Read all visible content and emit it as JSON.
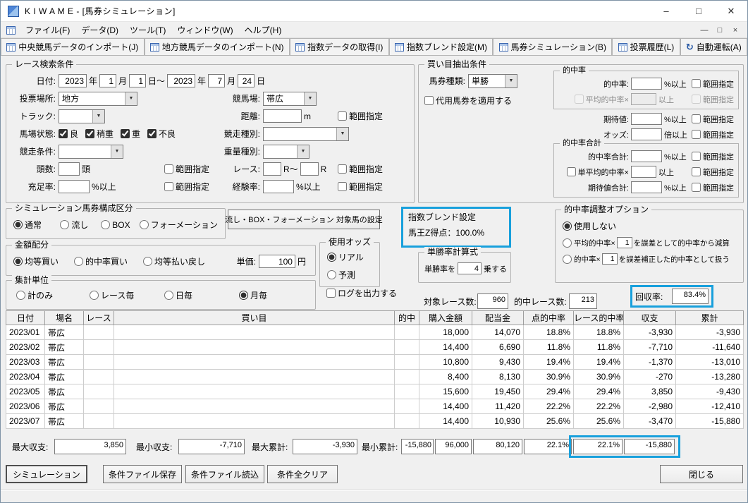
{
  "colors": {
    "highlight": "#18a0dc"
  },
  "icons": {
    "minimize": "–",
    "maximize": "□",
    "close": "✕",
    "dropdown": "▼",
    "auto_run": "↻",
    "mdi_minimize": "—",
    "mdi_restore": "□",
    "mdi_close": "×"
  },
  "labels": {
    "range": "範囲指定"
  },
  "titlebar": {
    "title": "K I W A M E - [馬券シミュレーション]"
  },
  "menubar": {
    "items": [
      "ファイル(F)",
      "データ(D)",
      "ツール(T)",
      "ウィンドウ(W)",
      "ヘルプ(H)"
    ]
  },
  "toolbar": {
    "buttons": [
      "中央競馬データのインポート(J)",
      "地方競馬データのインポート(N)",
      "指数データの取得(I)",
      "指数ブレンド設定(M)",
      "馬券シミュレーション(B)",
      "投票履歴(L)",
      "自動運転(A)"
    ]
  },
  "search": {
    "title": "レース検索条件",
    "date": {
      "label": "日付:",
      "year1": "2023",
      "year1_unit": "年",
      "month1": "1",
      "month1_unit": "月",
      "day1": "1",
      "day1_unit": "日～",
      "year2": "2023",
      "year2_unit": "年",
      "month2": "7",
      "month2_unit": "月",
      "day2": "24",
      "day2_unit": "日"
    },
    "place": {
      "label": "投票場所:",
      "value": "地方"
    },
    "course": {
      "label": "競馬場:",
      "value": "帯広"
    },
    "track": {
      "label": "トラック:",
      "value": ""
    },
    "distance": {
      "label": "距離:",
      "value": "",
      "unit": "m"
    },
    "condition": {
      "label": "馬場状態:",
      "options": [
        {
          "label": "良",
          "checked": true
        },
        {
          "label": "稍重",
          "checked": true
        },
        {
          "label": "重",
          "checked": true
        },
        {
          "label": "不良",
          "checked": true
        }
      ]
    },
    "race_type": {
      "label": "競走種別:",
      "value": ""
    },
    "race_cond": {
      "label": "競走条件:",
      "value": ""
    },
    "weight_type": {
      "label": "重量種別:",
      "value": ""
    },
    "heads": {
      "label": "頭数:",
      "value": "",
      "unit": "頭"
    },
    "race_no": {
      "label": "レース:",
      "value1": "",
      "unit1": "R～",
      "value2": "",
      "unit2": "R"
    },
    "fill_rate": {
      "label": "充足率:",
      "value": "",
      "unit": "%以上"
    },
    "exp_rate": {
      "label": "経験率:",
      "value": "",
      "unit": "%以上"
    }
  },
  "extract": {
    "title": "買い目抽出条件",
    "ticket_type": {
      "label": "馬券種類:",
      "value": "単勝"
    },
    "substitute": {
      "label": "代用馬券を適用する",
      "checked": false
    },
    "hit_group": {
      "title": "的中率"
    },
    "hit": {
      "label": "的中率:",
      "value": "",
      "unit": "%以上"
    },
    "avg_hit": {
      "label": "平均的中率×",
      "checked": false,
      "value": "",
      "unit": "以上"
    },
    "expect": {
      "label": "期待値:",
      "value": "",
      "unit": "%以上"
    },
    "odds": {
      "label": "オッズ:",
      "value": "",
      "unit": "倍以上"
    },
    "total_group": {
      "title": "的中率合計"
    },
    "hit_total": {
      "label": "的中率合計:",
      "value": "",
      "unit": "%以上"
    },
    "single_avg": {
      "label": "単平均的中率×",
      "checked": false,
      "value": "",
      "unit": "以上"
    },
    "expect_total": {
      "label": "期待値合計:",
      "value": "",
      "unit": "%以上"
    }
  },
  "composition": {
    "title": "シミュレーション馬券構成区分",
    "options": [
      {
        "label": "通常",
        "checked": true
      },
      {
        "label": "流し",
        "checked": false
      },
      {
        "label": "BOX",
        "checked": false
      },
      {
        "label": "フォーメーション",
        "checked": false
      }
    ],
    "target_button": "流し・BOX・フォーメーション 対象馬の設定"
  },
  "blend": {
    "title": "指数ブレンド設定",
    "text": "馬王Z得点：100.0%"
  },
  "adjust": {
    "title": "的中率調整オプション",
    "option1": {
      "label": "使用しない",
      "checked": true
    },
    "option2": {
      "pre": "平均的中率×",
      "value": "1",
      "post": "を誤差として的中率から減算",
      "checked": false
    },
    "option3": {
      "pre": "的中率×",
      "value": "1",
      "post": "を誤差補正した的中率として扱う",
      "checked": false
    }
  },
  "amount": {
    "title": "金額配分",
    "options": [
      {
        "label": "均等買い",
        "checked": true
      },
      {
        "label": "的中率買い",
        "checked": false
      },
      {
        "label": "均等払い戻し",
        "checked": false
      }
    ],
    "unit_price": {
      "label": "単価:",
      "value": "100",
      "unit": "円"
    }
  },
  "odds_use": {
    "title": "使用オッズ",
    "options": [
      {
        "label": "リアル",
        "checked": true
      },
      {
        "label": "予測",
        "checked": false
      }
    ]
  },
  "win_formula": {
    "title": "単勝率計算式",
    "pre": "単勝率を",
    "value": "4",
    "post": "乗する"
  },
  "aggregate": {
    "title": "集計単位",
    "options": [
      {
        "label": "計のみ",
        "checked": false
      },
      {
        "label": "レース毎",
        "checked": false
      },
      {
        "label": "日毎",
        "checked": false
      },
      {
        "label": "月毎",
        "checked": true
      }
    ]
  },
  "log_output": {
    "label": "ログを出力する",
    "checked": false
  },
  "stats": {
    "target_label": "対象レース数:",
    "target_value": "960",
    "hit_label": "的中レース数:",
    "hit_value": "213",
    "recovery_label": "回収率:",
    "recovery_value": "83.4%"
  },
  "table": {
    "columns": [
      "日付",
      "場名",
      "レース",
      "買い目",
      "的中",
      "購入金額",
      "配当金",
      "点的中率",
      "レース的中率",
      "収支",
      "累計"
    ],
    "row_keys": [
      "date",
      "place",
      "race",
      "kaime",
      "hit",
      "purchase",
      "payout",
      "point_rate",
      "race_rate",
      "balance",
      "total"
    ],
    "rows": [
      {
        "date": "2023/01",
        "place": "帯広",
        "race": "",
        "kaime": "",
        "hit": "",
        "purchase": "18,000",
        "payout": "14,070",
        "point_rate": "18.8%",
        "race_rate": "18.8%",
        "balance": "-3,930",
        "total": "-3,930"
      },
      {
        "date": "2023/02",
        "place": "帯広",
        "race": "",
        "kaime": "",
        "hit": "",
        "purchase": "14,400",
        "payout": "6,690",
        "point_rate": "11.8%",
        "race_rate": "11.8%",
        "balance": "-7,710",
        "total": "-11,640"
      },
      {
        "date": "2023/03",
        "place": "帯広",
        "race": "",
        "kaime": "",
        "hit": "",
        "purchase": "10,800",
        "payout": "9,430",
        "point_rate": "19.4%",
        "race_rate": "19.4%",
        "balance": "-1,370",
        "total": "-13,010"
      },
      {
        "date": "2023/04",
        "place": "帯広",
        "race": "",
        "kaime": "",
        "hit": "",
        "purchase": "8,400",
        "payout": "8,130",
        "point_rate": "30.9%",
        "race_rate": "30.9%",
        "balance": "-270",
        "total": "-13,280"
      },
      {
        "date": "2023/05",
        "place": "帯広",
        "race": "",
        "kaime": "",
        "hit": "",
        "purchase": "15,600",
        "payout": "19,450",
        "point_rate": "29.4%",
        "race_rate": "29.4%",
        "balance": "3,850",
        "total": "-9,430"
      },
      {
        "date": "2023/06",
        "place": "帯広",
        "race": "",
        "kaime": "",
        "hit": "",
        "purchase": "14,400",
        "payout": "11,420",
        "point_rate": "22.2%",
        "race_rate": "22.2%",
        "balance": "-2,980",
        "total": "-12,410"
      },
      {
        "date": "2023/07",
        "place": "帯広",
        "race": "",
        "kaime": "",
        "hit": "",
        "purchase": "14,400",
        "payout": "10,930",
        "point_rate": "25.6%",
        "race_rate": "25.6%",
        "balance": "-3,470",
        "total": "-15,880"
      }
    ]
  },
  "summary": {
    "max_balance": {
      "label": "最大収支:",
      "value": "3,850"
    },
    "min_balance": {
      "label": "最小収支:",
      "value": "-7,710"
    },
    "max_total": {
      "label": "最大累計:",
      "value": "-3,930"
    },
    "min_total": {
      "label": "最小累計:",
      "value": "-15,880"
    },
    "purchase_total": "96,000",
    "payout_total": "80,120",
    "point_rate_total": "22.1%",
    "race_rate_total": "22.1%",
    "balance_total": "-15,880"
  },
  "footer": {
    "buttons": [
      "シミュレーション",
      "条件ファイル保存",
      "条件ファイル読込",
      "条件全クリア"
    ],
    "close": "閉じる"
  }
}
